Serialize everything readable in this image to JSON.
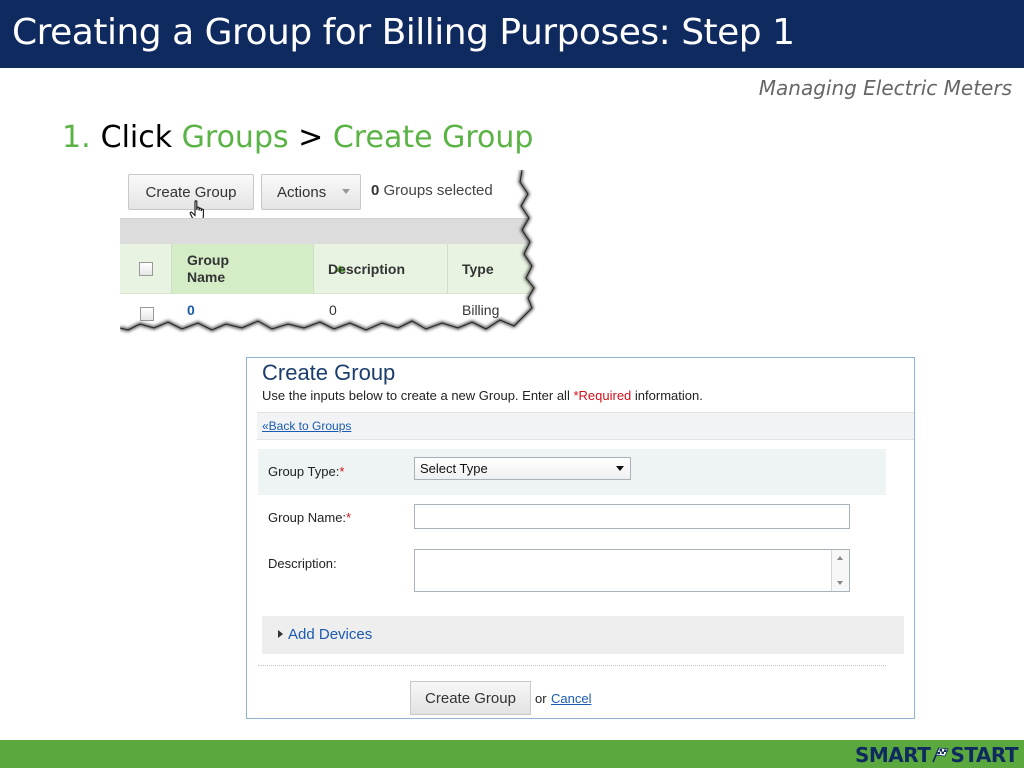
{
  "slide": {
    "title": "Creating a Group for Billing Purposes: Step 1",
    "subtitle": "Managing Electric Meters"
  },
  "instruction": {
    "number": "1.",
    "prefix": "Click",
    "link1": "Groups",
    "separator": ">",
    "link2": "Create Group"
  },
  "groups_table": {
    "toolbar": {
      "create_label": "Create Group",
      "actions_label": "Actions",
      "selected_count": "0",
      "selected_text": "Groups selected"
    },
    "columns": [
      "Group Name",
      "Description",
      "Type"
    ],
    "rows": [
      {
        "name": "0",
        "description": "0",
        "type": "Billing"
      }
    ]
  },
  "form": {
    "title": "Create Group",
    "description_prefix": "Use the inputs below to create a new Group. Enter all",
    "description_required": "*Required",
    "description_suffix": "information.",
    "back_link": "«Back to Groups",
    "fields": {
      "group_type_label": "Group Type:",
      "group_type_value": "Select Type",
      "group_name_label": "Group Name:",
      "group_name_value": "",
      "description_label": "Description:"
    },
    "required_mark": "*",
    "add_devices_label": "Add Devices",
    "submit_label": "Create Group",
    "or_text": "or",
    "cancel_label": "Cancel"
  },
  "footer": {
    "logo_left": "SMART",
    "logo_right": "START"
  },
  "colors": {
    "title_bar": "#0f2a5f",
    "accent_green": "#5bb345",
    "footer_green": "#5ba83f",
    "link_blue": "#1a5ab0",
    "required_red": "#d0101a"
  }
}
